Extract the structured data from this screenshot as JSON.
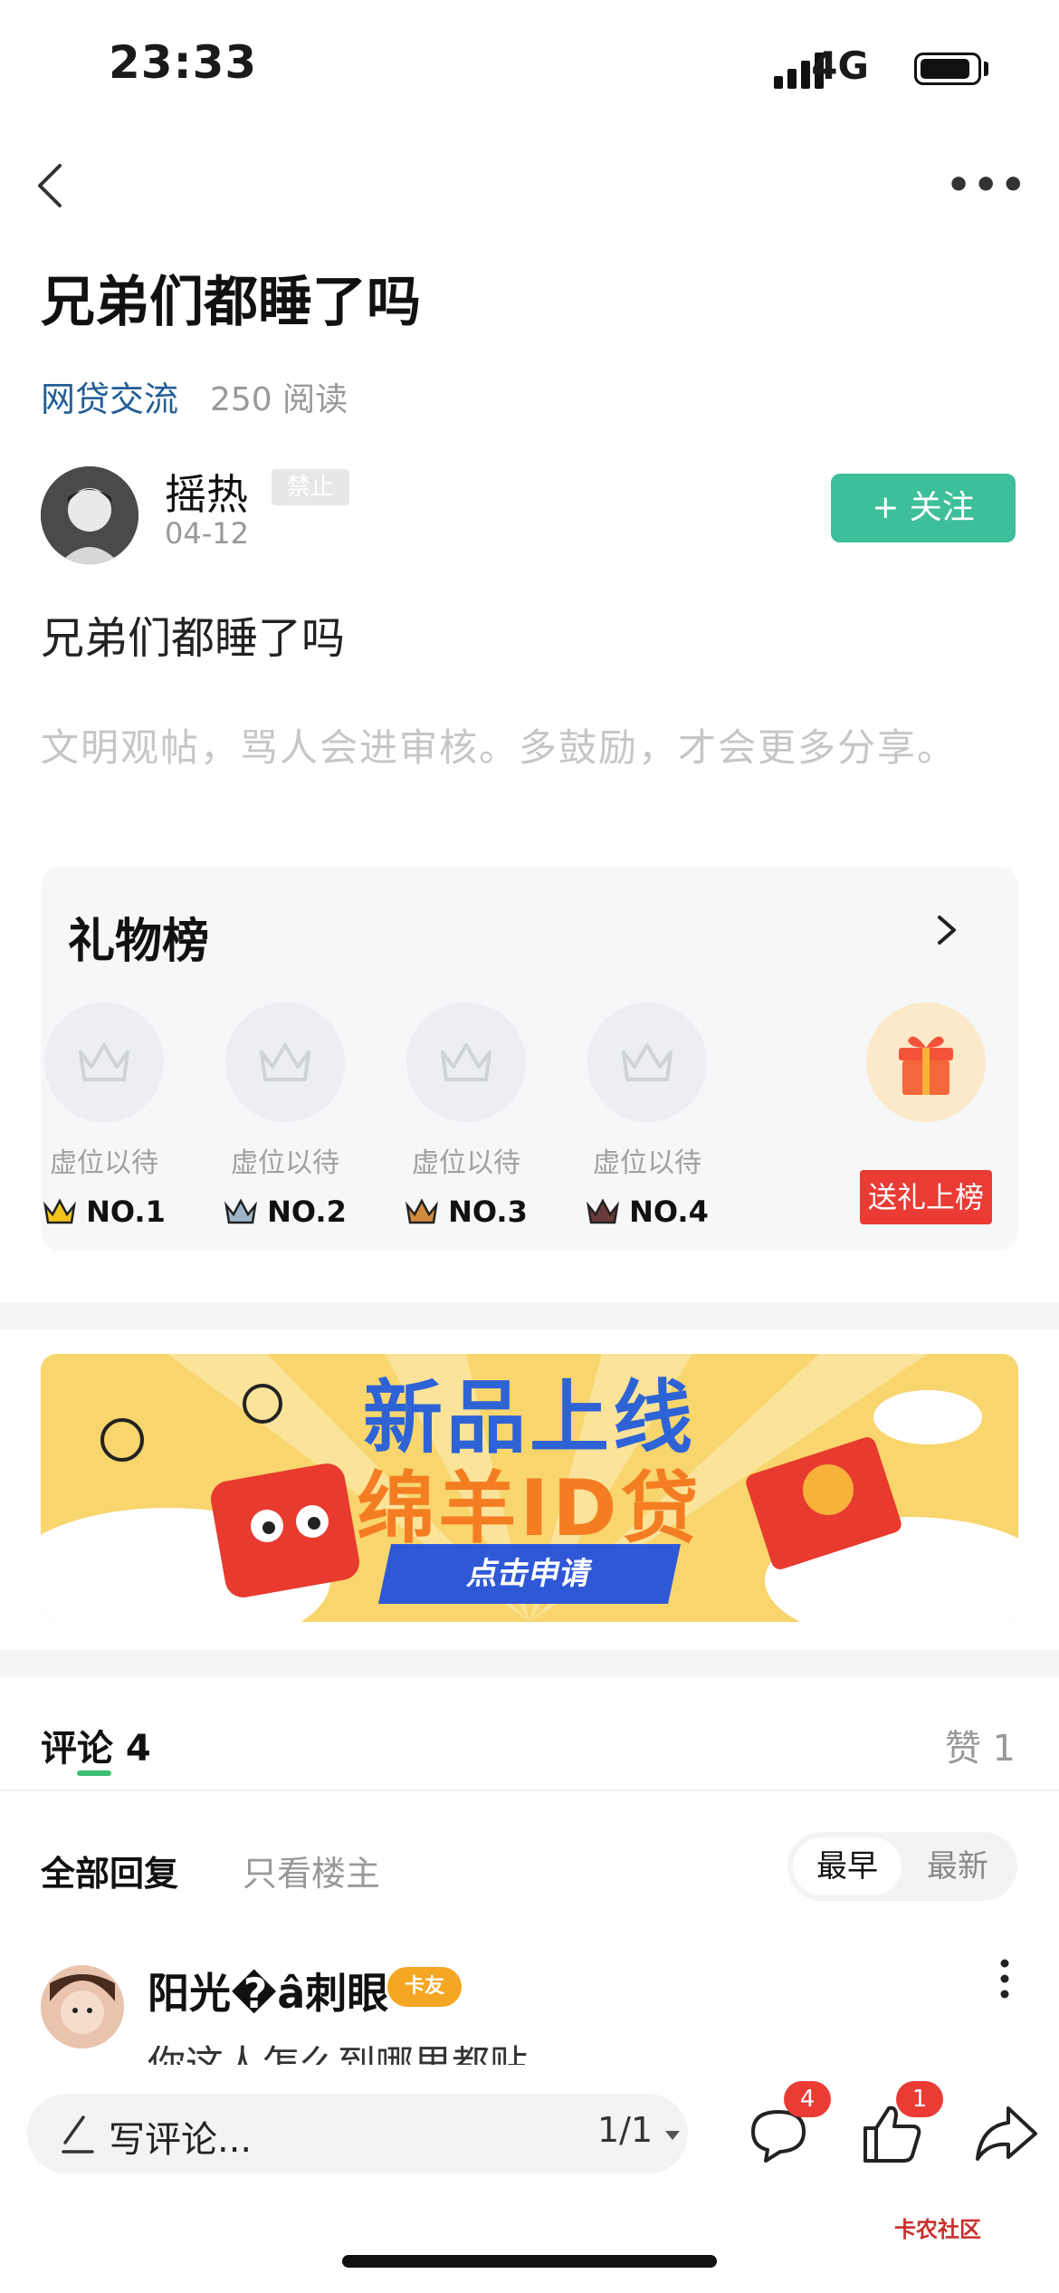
{
  "status_bar": {
    "time": "23:33",
    "network": "4G"
  },
  "post": {
    "title": "兄弟们都睡了吗",
    "category": "网贷交流",
    "reads": "250 阅读",
    "author": "摇热",
    "author_tag": "禁止",
    "date": "04-12",
    "follow_label": "+ 关注",
    "content": "兄弟们都睡了吗",
    "hint": "文明观帖，骂人会进审核。多鼓励，才会更多分享。"
  },
  "gift_board": {
    "title": "礼物榜",
    "slots": [
      {
        "label": "虚位以待",
        "rank": "NO.1",
        "crown_color": "#f3c41c"
      },
      {
        "label": "虚位以待",
        "rank": "NO.2",
        "crown_color": "#9fb4c6"
      },
      {
        "label": "虚位以待",
        "rank": "NO.3",
        "crown_color": "#d28a3c"
      },
      {
        "label": "虚位以待",
        "rank": "NO.4",
        "crown_color": "#6b3a3a"
      }
    ],
    "send_label": "送礼上榜"
  },
  "banner": {
    "line1": "新品上线",
    "line2": "绵羊ID贷",
    "cta": "点击申请"
  },
  "comments_header": {
    "tab_comment": "评论 4",
    "tab_like": "赞 1",
    "filter_all": "全部回复",
    "filter_op": "只看楼主",
    "sort_early": "最早",
    "sort_new": "最新"
  },
  "comment": {
    "name": "阳光�â刺眼",
    "badge": "卡友",
    "text": "你这人怎么到哪里都贴"
  },
  "bottom_bar": {
    "write_placeholder": "写评论...",
    "page": "1/1",
    "comment_count": "4",
    "like_count": "1"
  },
  "watermark": "卡农社区",
  "colors": {
    "accent": "#3cbf9a",
    "link": "#235e96",
    "danger": "#ea3b35"
  }
}
